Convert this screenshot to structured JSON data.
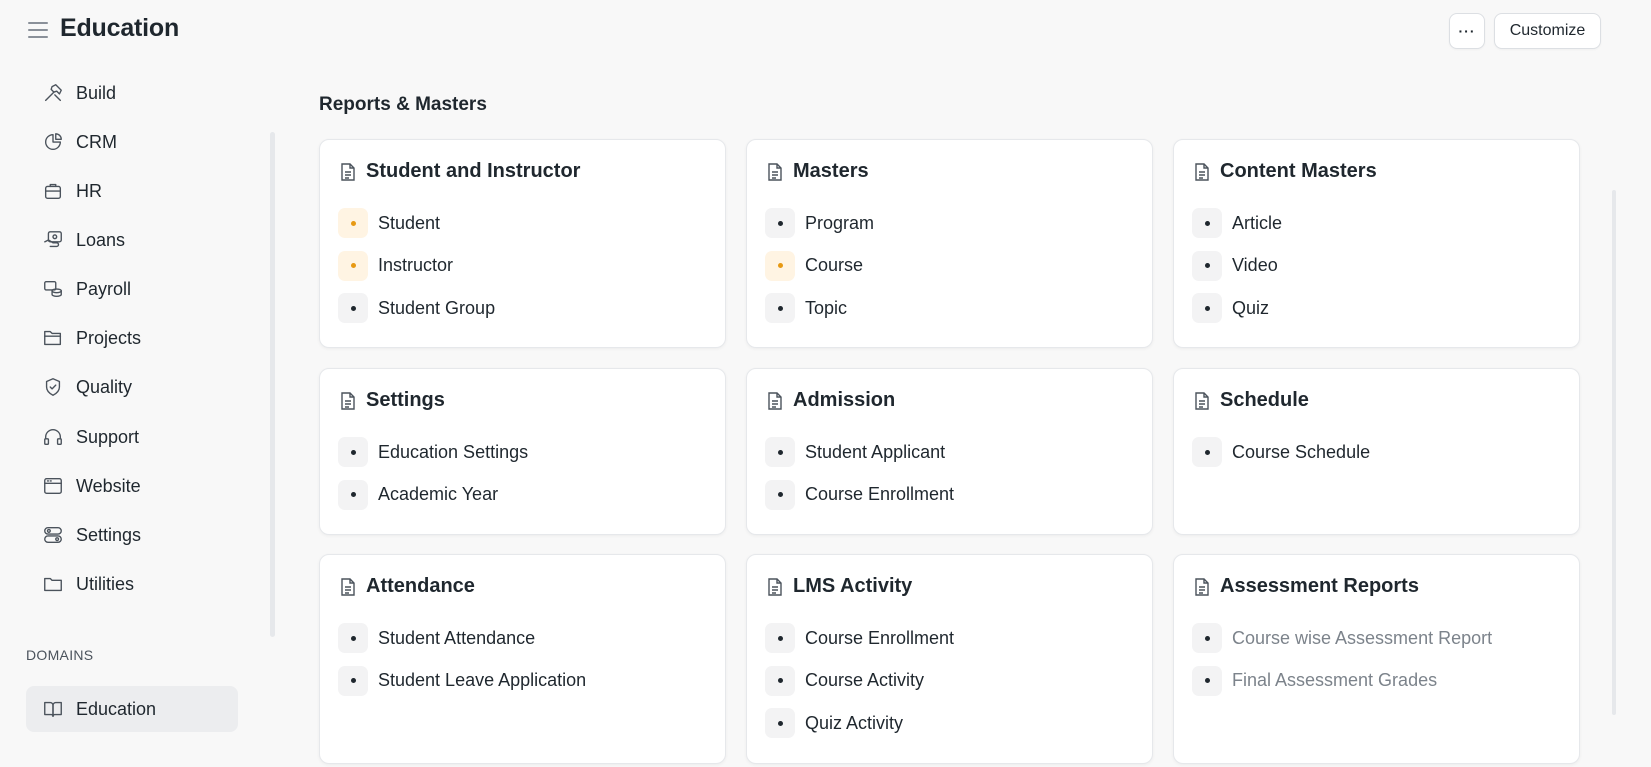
{
  "header": {
    "title": "Education",
    "more_label": "···",
    "customize_label": "Customize"
  },
  "sidebar": {
    "items": [
      {
        "label": "Build",
        "icon": "hammer-icon"
      },
      {
        "label": "CRM",
        "icon": "pie-chart-icon"
      },
      {
        "label": "HR",
        "icon": "briefcase-icon"
      },
      {
        "label": "Loans",
        "icon": "hand-money-icon"
      },
      {
        "label": "Payroll",
        "icon": "coins-icon"
      },
      {
        "label": "Projects",
        "icon": "folder-open-icon"
      },
      {
        "label": "Quality",
        "icon": "badge-check-icon"
      },
      {
        "label": "Support",
        "icon": "headset-icon"
      },
      {
        "label": "Website",
        "icon": "browser-window-icon"
      },
      {
        "label": "Settings",
        "icon": "toggle-settings-icon"
      },
      {
        "label": "Utilities",
        "icon": "folder-icon"
      }
    ],
    "domains_label": "DOMAINS",
    "domain_active": {
      "label": "Education",
      "icon": "book-open-icon"
    }
  },
  "main": {
    "section_title": "Reports & Masters",
    "cards": [
      {
        "title": "Student and Instructor",
        "links": [
          {
            "label": "Student",
            "status": "warning"
          },
          {
            "label": "Instructor",
            "status": "warning"
          },
          {
            "label": "Student Group",
            "status": "normal"
          }
        ]
      },
      {
        "title": "Masters",
        "links": [
          {
            "label": "Program",
            "status": "normal"
          },
          {
            "label": "Course",
            "status": "warning"
          },
          {
            "label": "Topic",
            "status": "normal"
          }
        ]
      },
      {
        "title": "Content Masters",
        "links": [
          {
            "label": "Article",
            "status": "normal"
          },
          {
            "label": "Video",
            "status": "normal"
          },
          {
            "label": "Quiz",
            "status": "normal"
          }
        ]
      },
      {
        "title": "Settings",
        "links": [
          {
            "label": "Education Settings",
            "status": "normal"
          },
          {
            "label": "Academic Year",
            "status": "normal"
          }
        ]
      },
      {
        "title": "Admission",
        "links": [
          {
            "label": "Student Applicant",
            "status": "normal"
          },
          {
            "label": "Course Enrollment",
            "status": "normal"
          }
        ]
      },
      {
        "title": "Schedule",
        "links": [
          {
            "label": "Course Schedule",
            "status": "normal"
          }
        ]
      },
      {
        "title": "Attendance",
        "links": [
          {
            "label": "Student Attendance",
            "status": "normal"
          },
          {
            "label": "Student Leave Application",
            "status": "normal"
          }
        ]
      },
      {
        "title": "LMS Activity",
        "links": [
          {
            "label": "Course Enrollment",
            "status": "normal"
          },
          {
            "label": "Course Activity",
            "status": "normal"
          },
          {
            "label": "Quiz Activity",
            "status": "normal"
          }
        ]
      },
      {
        "title": "Assessment Reports",
        "links": [
          {
            "label": "Course wise Assessment Report",
            "status": "disabled"
          },
          {
            "label": "Final Assessment Grades",
            "status": "disabled"
          }
        ]
      }
    ]
  },
  "colors": {
    "warning_dot": "#e79913",
    "warning_bg": "#fff4e3",
    "muted_text": "#7c838b",
    "active_bg": "#ecedef"
  }
}
